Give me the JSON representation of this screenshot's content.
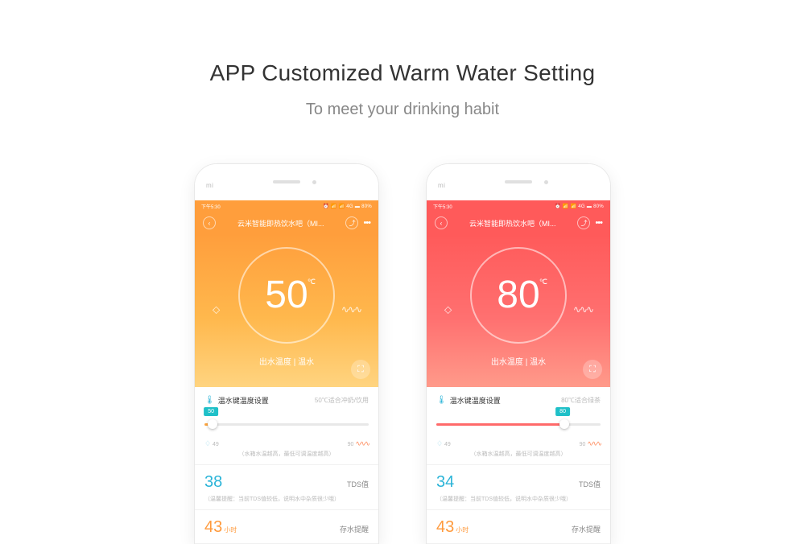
{
  "heading": {
    "title": "APP Customized Warm Water Setting",
    "subtitle": "To meet your drinking habit"
  },
  "common": {
    "brand": "mi",
    "status_time": "下午5:30",
    "status_icons": "⏰ 📶 📶 4G ▬ 80%",
    "app_title": "云米智能即热饮水吧（MI...",
    "output_label": "出水温度 | 温水",
    "setting_label": "温水键温度设置",
    "slider_min": "49",
    "slider_max": "90",
    "slider_note": "（水箱水温越高，最低可调温度越高）",
    "tds_label": "TDS值",
    "tds_note": "（温馨提醒：当前TDS值较低，说明水中杂质很少哦）",
    "hours_unit": "小时",
    "reminder_label": "存水提醒"
  },
  "phone1": {
    "temp": "50",
    "deg": "℃",
    "suggest": "50℃适合冲奶/饮用",
    "slider_val": "50",
    "tds_val": "38",
    "hours_val": "43"
  },
  "phone2": {
    "temp": "80",
    "deg": "℃",
    "suggest": "80℃适合绿茶",
    "slider_val": "80",
    "tds_val": "34",
    "hours_val": "43"
  }
}
